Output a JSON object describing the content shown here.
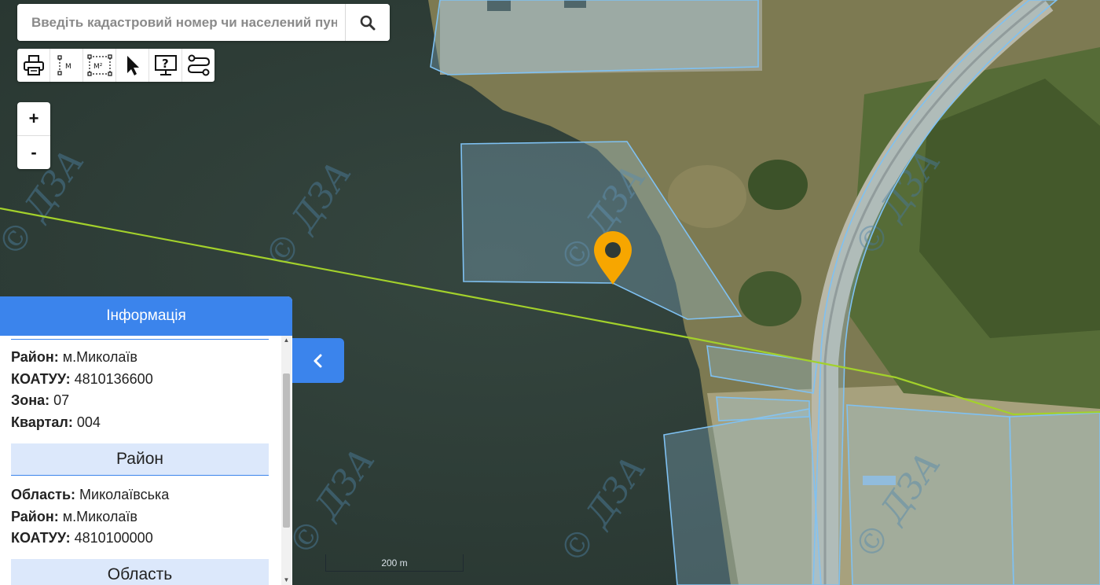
{
  "search": {
    "placeholder": "Введіть кадастровий номер чи населений пункт"
  },
  "toolbar": {
    "tools": [
      "printer-icon",
      "measure-distance-icon",
      "measure-area-icon",
      "pointer-icon",
      "help-icon",
      "route-icon"
    ],
    "measure_distance_unit": "M",
    "measure_area_unit": "M²"
  },
  "zoom": {
    "in_label": "+",
    "out_label": "-"
  },
  "watermark": "© ДЗА",
  "info_panel": {
    "title": "Інформація",
    "group1": {
      "raion_label": "Район:",
      "raion_value": "м.Миколаїв",
      "koatuu_label": "КОАТУУ:",
      "koatuu_value": "4810136600",
      "zona_label": "Зона:",
      "zona_value": "07",
      "kvartal_label": "Квартал:",
      "kvartal_value": "004"
    },
    "section_raion": "Район",
    "group2": {
      "oblast_label": "Область:",
      "oblast_value": "Миколаївська",
      "raion_label": "Район:",
      "raion_value": "м.Миколаїв",
      "koatuu_label": "КОАТУУ:",
      "koatuu_value": "4810100000"
    },
    "section_oblast": "Область"
  },
  "scale_label": "200 m",
  "colors": {
    "accent": "#3b84ec",
    "parcel_stroke": "#7fc1f2",
    "boundary_line": "#a3d12b",
    "marker": "#f7a600"
  }
}
